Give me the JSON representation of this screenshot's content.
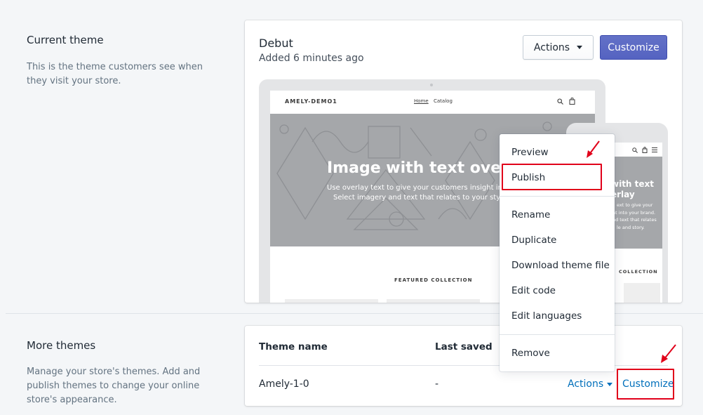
{
  "current_theme_section": {
    "title": "Current theme",
    "description_line1": "This is the theme customers see when",
    "description_line2": "they visit your store."
  },
  "current_theme_card": {
    "theme_name": "Debut",
    "added": "Added 6 minutes ago",
    "actions_label": "Actions",
    "customize_label": "Customize"
  },
  "preview": {
    "store_name": "AMELY-DEMO1",
    "nav_home": "Home",
    "nav_catalog": "Catalog",
    "hero_title": "Image with text ove",
    "hero_sub_line1": "Use overlay text to give your customers insight into",
    "hero_sub_line2": "Select imagery and text that relates to your style",
    "featured_collection": "FEATURED COLLECTION",
    "mobile_hero_line1": "with text",
    "mobile_hero_line2": "erlay",
    "mobile_sub_line1": "ext to give your",
    "mobile_sub_line2": "ht into your brand.",
    "mobile_sub_line3": "nd text that relates",
    "mobile_sub_line4": "le and story.",
    "mobile_collection": "COLLECTION"
  },
  "actions_menu": {
    "items": [
      "Preview",
      "Publish",
      "Rename",
      "Duplicate",
      "Download theme file",
      "Edit code",
      "Edit languages",
      "Remove"
    ]
  },
  "more_themes_section": {
    "title": "More themes",
    "description_line1": "Manage your store's themes. Add and",
    "description_line2": "publish themes to change your online",
    "description_line3": "store's appearance."
  },
  "more_themes_table": {
    "col_theme_name": "Theme name",
    "col_last_saved": "Last saved",
    "rows": [
      {
        "name": "Amely-1-0",
        "last_saved": "-",
        "actions": "Actions",
        "customize": "Customize"
      }
    ]
  },
  "colors": {
    "primary": "#5c6ac4",
    "link": "#006fbb",
    "annotation": "#e1001a"
  },
  "icons": [
    "caret-down-icon",
    "search-icon",
    "cart-icon",
    "hamburger-icon",
    "red-arrow-annotation"
  ]
}
